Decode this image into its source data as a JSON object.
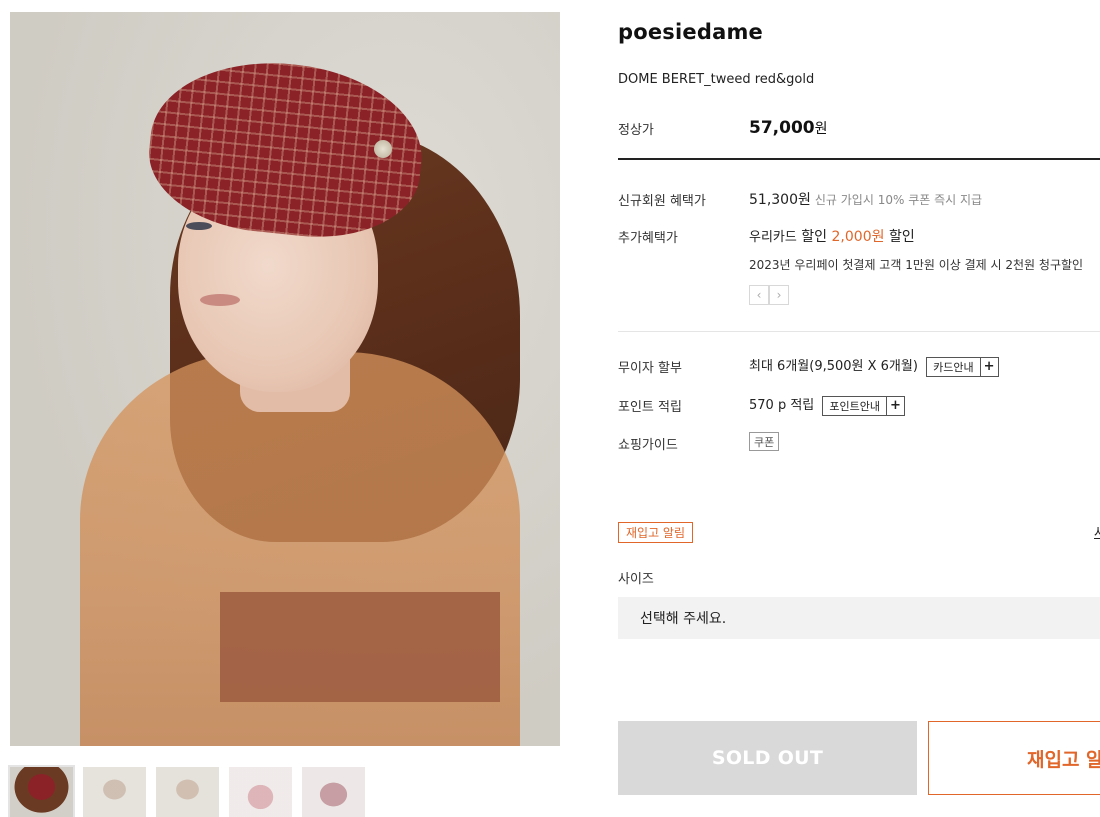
{
  "product": {
    "brand": "poesiedame",
    "name": "DOME BERET_tweed red&gold"
  },
  "price": {
    "label": "정상가",
    "amount": "57,000",
    "unit": "원"
  },
  "benefits": {
    "member_label": "신규회원 혜택가",
    "member_price": "51,300원",
    "member_note": "신규 가입시 10% 쿠폰 즉시 지급",
    "extra_label": "추가혜택가",
    "card_prefix": "우리카드",
    "card_discount_word": "할인",
    "card_amount": "2,000원",
    "card_suffix": "할인",
    "pay_note": "2023년 우리페이 첫결제 고객 1만원 이상 결제 시 2천원 청구할인",
    "prev_arrow": "‹",
    "next_arrow": "›"
  },
  "installment": {
    "label": "무이자 할부",
    "value": "최대 6개월(9,500원 X 6개월)",
    "button_label": "카드안내",
    "button_plus": "+"
  },
  "points": {
    "label": "포인트 적립",
    "value": "570 p 적립",
    "button_label": "포인트안내",
    "button_plus": "+"
  },
  "guide": {
    "label": "쇼핑가이드",
    "coupon_tag": "쿠폰"
  },
  "restock_badge": "재입고 알림",
  "edge_link": "사",
  "size": {
    "label": "사이즈",
    "placeholder": "선택해 주세요."
  },
  "actions": {
    "soldout": "SOLD OUT",
    "restock": "재입고 알림"
  },
  "colors": {
    "accent": "#e0662a",
    "soldout_bg": "#d9d9d9",
    "select_bg": "#f2f2f2"
  }
}
